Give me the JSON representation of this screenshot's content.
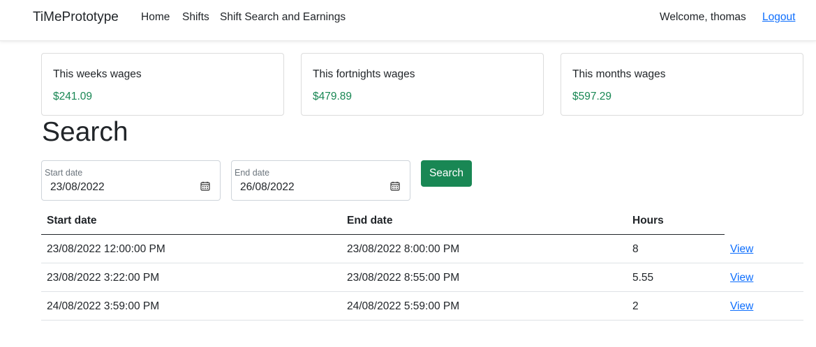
{
  "nav": {
    "brand": "TiMePrototype",
    "links": [
      "Home",
      "Shifts",
      "Shift Search and Earnings"
    ],
    "welcome": "Welcome, thomas",
    "logout": "Logout"
  },
  "wages": [
    {
      "title": "This weeks wages",
      "value": "$241.09"
    },
    {
      "title": "This fortnights wages",
      "value": "$479.89"
    },
    {
      "title": "This months wages",
      "value": "$597.29"
    }
  ],
  "search": {
    "title": "Search",
    "start_label": "Start date",
    "start_value": "23/08/2022",
    "end_label": "End date",
    "end_value": "26/08/2022",
    "button": "Search"
  },
  "table": {
    "headers": [
      "Start date",
      "End date",
      "Hours"
    ],
    "rows": [
      {
        "start": "23/08/2022 12:00:00 PM",
        "end": "23/08/2022 8:00:00 PM",
        "hours": "8",
        "action": "View"
      },
      {
        "start": "23/08/2022 3:22:00 PM",
        "end": "23/08/2022 8:55:00 PM",
        "hours": "5.55",
        "action": "View"
      },
      {
        "start": "24/08/2022 3:59:00 PM",
        "end": "24/08/2022 5:59:00 PM",
        "hours": "2",
        "action": "View"
      }
    ]
  },
  "colors": {
    "accent": "#198754",
    "link": "#0d6efd"
  }
}
